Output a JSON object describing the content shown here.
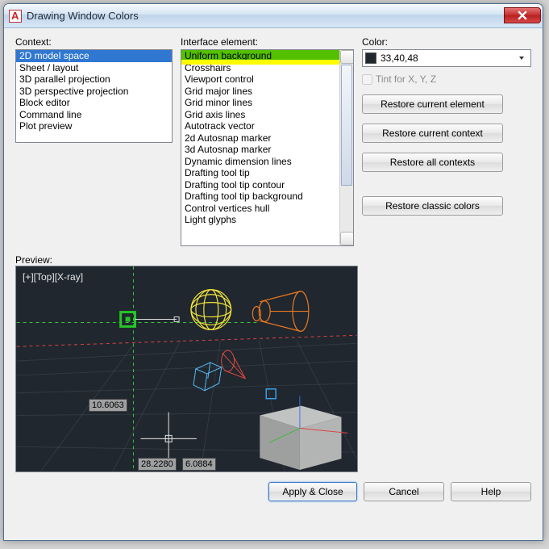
{
  "window": {
    "title": "Drawing Window Colors"
  },
  "labels": {
    "context": "Context:",
    "element": "Interface element:",
    "color": "Color:",
    "tint": "Tint for X, Y, Z",
    "preview": "Preview:"
  },
  "context_items": [
    "2D model space",
    "Sheet / layout",
    "3D parallel projection",
    "3D perspective projection",
    "Block editor",
    "Command line",
    "Plot preview"
  ],
  "context_selected": 0,
  "element_items": [
    "Uniform background",
    "Crosshairs",
    "Viewport control",
    "Grid major lines",
    "Grid minor lines",
    "Grid axis lines",
    "Autotrack vector",
    "2d Autosnap marker",
    "3d Autosnap marker",
    "Dynamic dimension lines",
    "Drafting tool tip",
    "Drafting tool tip contour",
    "Drafting tool tip background",
    "Control vertices hull",
    "Light glyphs"
  ],
  "element_selected": 0,
  "color_value": "33,40,48",
  "buttons": {
    "restore_element": "Restore current element",
    "restore_context": "Restore current context",
    "restore_all": "Restore all contexts",
    "restore_classic": "Restore classic colors",
    "apply": "Apply & Close",
    "cancel": "Cancel",
    "help": "Help"
  },
  "preview": {
    "label": "[+][Top][X-ray]",
    "coord1": "10.6063",
    "coord2": "28.2280",
    "coord3": "6.0884"
  }
}
